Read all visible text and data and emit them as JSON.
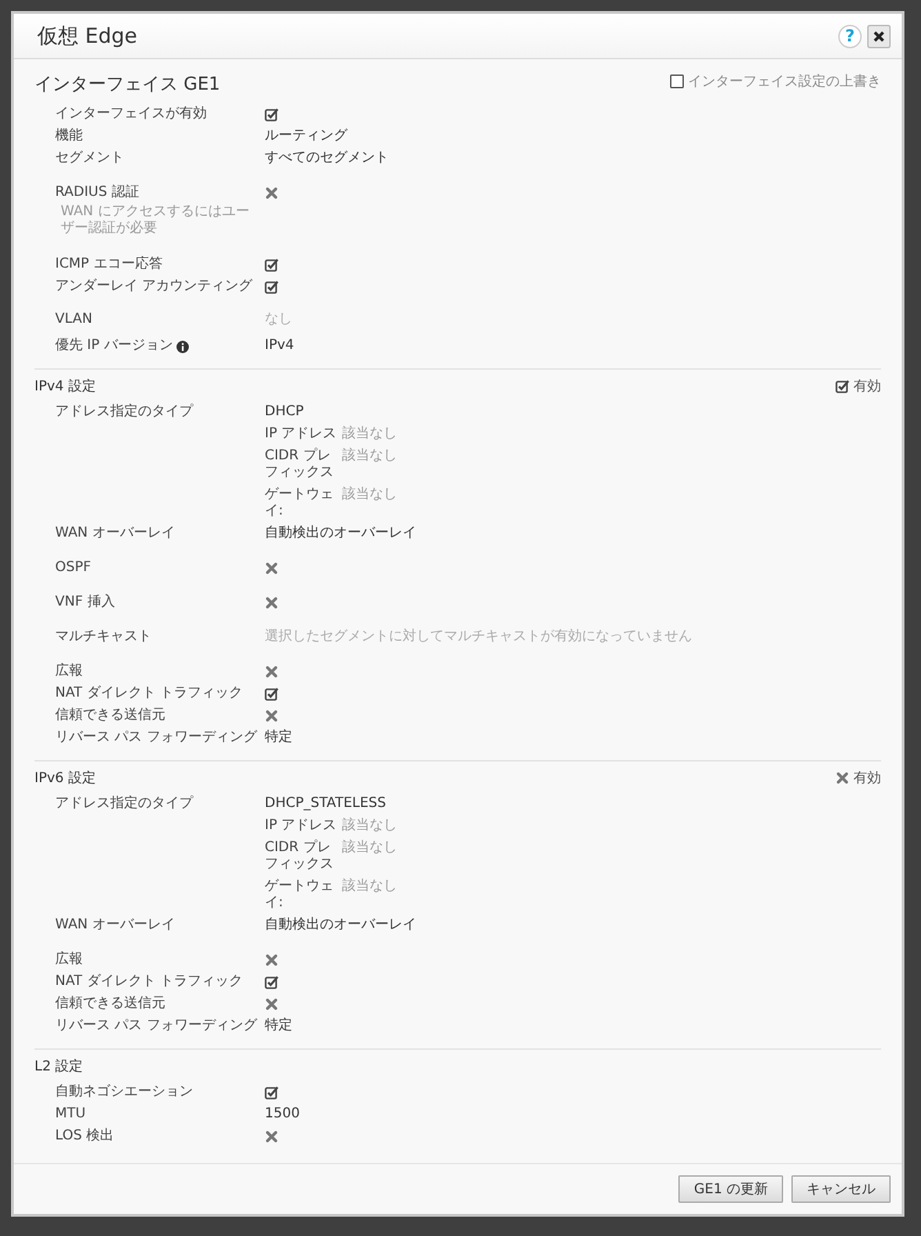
{
  "window": {
    "title": "仮想 Edge",
    "help": "?"
  },
  "interface": {
    "title": "インターフェイス GE1",
    "override": {
      "label": "インターフェイス設定の上書き",
      "checked": false
    }
  },
  "sections": [
    {
      "rows": [
        {
          "kind": "check",
          "label": "インターフェイスが有効",
          "checked": true
        },
        {
          "kind": "text",
          "label": "機能",
          "value": "ルーティング"
        },
        {
          "kind": "text",
          "label": "セグメント",
          "value": "すべてのセグメント"
        },
        {
          "kind": "check",
          "label": "RADIUS 認証",
          "note": "WAN にアクセスするにはユーザー認証が必要",
          "checked": false
        },
        {
          "kind": "check",
          "label": "ICMP エコー応答",
          "checked": true
        },
        {
          "kind": "check",
          "label": "アンダーレイ アカウンティング",
          "checked": true
        },
        {
          "kind": "muted",
          "label": "VLAN",
          "value": "なし"
        },
        {
          "kind": "text",
          "label": "優先 IP バージョン",
          "info_icon": true,
          "value": "IPv4"
        }
      ]
    },
    {
      "title": "IPv4 設定",
      "enabled": {
        "label": "有効",
        "checked": true
      },
      "rows": [
        {
          "kind": "address",
          "label": "アドレス指定のタイプ",
          "value": "DHCP",
          "items": [
            {
              "label": "IP アドレス",
              "value": "該当なし"
            },
            {
              "label": "CIDR プレフィックス",
              "value": "該当なし"
            },
            {
              "label": "ゲートウェイ:",
              "value": "該当なし"
            }
          ]
        },
        {
          "kind": "text",
          "label": "WAN オーバーレイ",
          "value": "自動検出のオーバーレイ"
        },
        {
          "kind": "check",
          "label": "OSPF",
          "checked": false
        },
        {
          "kind": "check",
          "label": "VNF 挿入",
          "checked": false
        },
        {
          "kind": "muted",
          "label": "マルチキャスト",
          "value": "選択したセグメントに対してマルチキャストが有効になっていません"
        },
        {
          "kind": "check",
          "label": "広報",
          "checked": false
        },
        {
          "kind": "check",
          "label": "NAT ダイレクト トラフィック",
          "checked": true
        },
        {
          "kind": "check",
          "label": "信頼できる送信元",
          "checked": false
        },
        {
          "kind": "text",
          "label": "リバース パス フォワーディング",
          "value": "特定"
        }
      ]
    },
    {
      "title": "IPv6 設定",
      "enabled": {
        "label": "有効",
        "checked": false
      },
      "rows": [
        {
          "kind": "address",
          "label": "アドレス指定のタイプ",
          "value": "DHCP_STATELESS",
          "items": [
            {
              "label": "IP アドレス",
              "value": "該当なし"
            },
            {
              "label": "CIDR プレフィックス",
              "value": "該当なし"
            },
            {
              "label": "ゲートウェイ:",
              "value": "該当なし"
            }
          ]
        },
        {
          "kind": "text",
          "label": "WAN オーバーレイ",
          "value": "自動検出のオーバーレイ"
        },
        {
          "kind": "check",
          "label": "広報",
          "checked": false
        },
        {
          "kind": "check",
          "label": "NAT ダイレクト トラフィック",
          "checked": true
        },
        {
          "kind": "check",
          "label": "信頼できる送信元",
          "checked": false
        },
        {
          "kind": "text",
          "label": "リバース パス フォワーディング",
          "value": "特定"
        }
      ]
    },
    {
      "title": "L2 設定",
      "rows": [
        {
          "kind": "check",
          "label": "自動ネゴシエーション",
          "checked": true
        },
        {
          "kind": "text",
          "label": "MTU",
          "value": "1500"
        },
        {
          "kind": "check",
          "label": "LOS 検出",
          "checked": false
        }
      ]
    }
  ],
  "buttons": [
    "GE1 の更新",
    "キャンセル"
  ]
}
